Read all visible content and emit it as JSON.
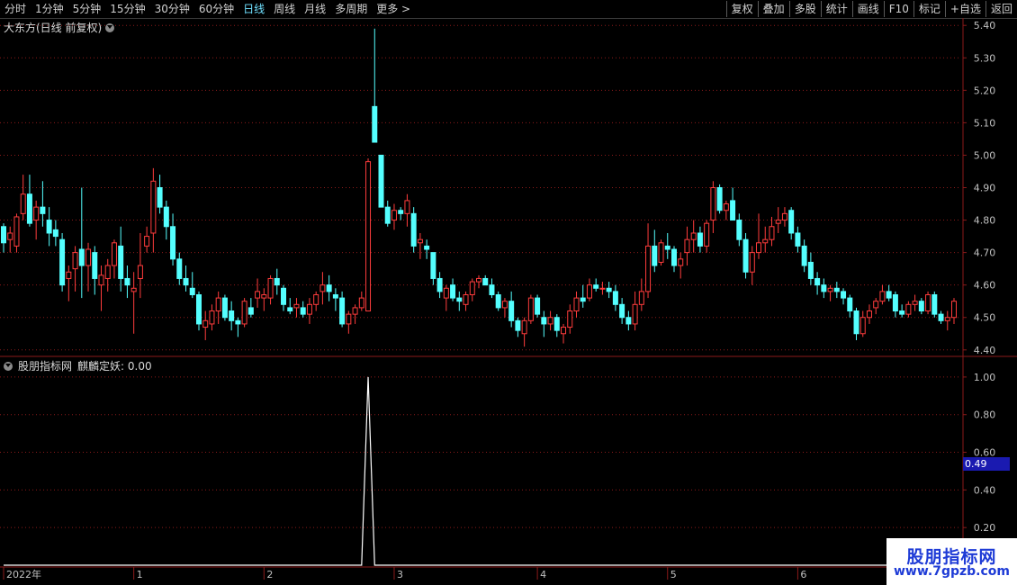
{
  "toolbar": {
    "left_tabs": [
      "分时",
      "1分钟",
      "5分钟",
      "15分钟",
      "30分钟",
      "60分钟",
      "日线",
      "周线",
      "月线",
      "多周期",
      "更多 >"
    ],
    "active_tab": "日线",
    "right_buttons": [
      "复权",
      "叠加",
      "多股",
      "统计",
      "画线",
      "F10",
      "标记",
      "+自选",
      "返回"
    ]
  },
  "main_chart": {
    "title": "大东方(日线 前复权)",
    "y_ticks": [
      "5.40",
      "5.30",
      "5.20",
      "5.10",
      "5.00",
      "4.90",
      "4.80",
      "4.70",
      "4.60",
      "4.50",
      "4.40"
    ]
  },
  "indicator": {
    "source": "股朋指标网",
    "name": "麒麟定妖",
    "value_label": "0.00",
    "y_ticks": [
      "1.00",
      "0.80",
      "0.60",
      "0.40",
      "0.20"
    ],
    "current_value": "0.49"
  },
  "x_axis": {
    "labels": [
      "2022年",
      "1",
      "2",
      "3",
      "4",
      "5",
      "6"
    ]
  },
  "watermark": {
    "line1": "股朋指标网",
    "line2": "www.7gpzb.com"
  },
  "colors": {
    "up": "#ff3c3c",
    "down": "#54ffff",
    "grid": "#8b1a1a",
    "active_tab": "#6fe0ff"
  },
  "chart_data": {
    "type": "candlestick",
    "note_series": "daily OHLC, 2022",
    "candles": [
      [
        4.78,
        4.79,
        4.7,
        4.73
      ],
      [
        4.74,
        4.78,
        4.7,
        4.76
      ],
      [
        4.72,
        4.82,
        4.7,
        4.81
      ],
      [
        4.82,
        4.94,
        4.8,
        4.88
      ],
      [
        4.88,
        4.94,
        4.78,
        4.79
      ],
      [
        4.8,
        4.86,
        4.74,
        4.84
      ],
      [
        4.84,
        4.92,
        4.78,
        4.82
      ],
      [
        4.8,
        4.84,
        4.72,
        4.76
      ],
      [
        4.77,
        4.8,
        4.72,
        4.75
      ],
      [
        4.74,
        4.76,
        4.58,
        4.6
      ],
      [
        4.62,
        4.66,
        4.55,
        4.64
      ],
      [
        4.65,
        4.72,
        4.58,
        4.7
      ],
      [
        4.71,
        4.9,
        4.56,
        4.66
      ],
      [
        4.66,
        4.73,
        4.58,
        4.71
      ],
      [
        4.7,
        4.72,
        4.57,
        4.62
      ],
      [
        4.6,
        4.66,
        4.52,
        4.63
      ],
      [
        4.62,
        4.68,
        4.58,
        4.66
      ],
      [
        4.66,
        4.74,
        4.62,
        4.73
      ],
      [
        4.72,
        4.78,
        4.58,
        4.62
      ],
      [
        4.62,
        4.66,
        4.56,
        4.6
      ],
      [
        4.58,
        4.64,
        4.45,
        4.59
      ],
      [
        4.62,
        4.76,
        4.56,
        4.66
      ],
      [
        4.72,
        4.78,
        4.7,
        4.75
      ],
      [
        4.76,
        4.96,
        4.7,
        4.92
      ],
      [
        4.9,
        4.94,
        4.82,
        4.84
      ],
      [
        4.84,
        4.86,
        4.74,
        4.78
      ],
      [
        4.78,
        4.82,
        4.66,
        4.68
      ],
      [
        4.68,
        4.7,
        4.6,
        4.62
      ],
      [
        4.62,
        4.66,
        4.58,
        4.6
      ],
      [
        4.59,
        4.64,
        4.56,
        4.57
      ],
      [
        4.57,
        4.58,
        4.46,
        4.48
      ],
      [
        4.47,
        4.52,
        4.43,
        4.49
      ],
      [
        4.48,
        4.54,
        4.46,
        4.52
      ],
      [
        4.52,
        4.58,
        4.48,
        4.56
      ],
      [
        4.56,
        4.57,
        4.49,
        4.5
      ],
      [
        4.52,
        4.55,
        4.46,
        4.49
      ],
      [
        4.49,
        4.5,
        4.44,
        4.48
      ],
      [
        4.48,
        4.56,
        4.47,
        4.55
      ],
      [
        4.53,
        4.56,
        4.5,
        4.51
      ],
      [
        4.56,
        4.62,
        4.53,
        4.58
      ],
      [
        4.56,
        4.59,
        4.52,
        4.57
      ],
      [
        4.56,
        4.63,
        4.54,
        4.62
      ],
      [
        4.62,
        4.65,
        4.57,
        4.6
      ],
      [
        4.59,
        4.6,
        4.52,
        4.54
      ],
      [
        4.53,
        4.56,
        4.51,
        4.52
      ],
      [
        4.53,
        4.56,
        4.5,
        4.54
      ],
      [
        4.53,
        4.55,
        4.5,
        4.51
      ],
      [
        4.51,
        4.56,
        4.48,
        4.54
      ],
      [
        4.54,
        4.58,
        4.52,
        4.57
      ],
      [
        4.58,
        4.64,
        4.54,
        4.6
      ],
      [
        4.6,
        4.63,
        4.55,
        4.58
      ],
      [
        4.57,
        4.59,
        4.52,
        4.56
      ],
      [
        4.56,
        4.58,
        4.47,
        4.48
      ],
      [
        4.48,
        4.52,
        4.45,
        4.51
      ],
      [
        4.51,
        4.54,
        4.48,
        4.53
      ],
      [
        4.53,
        4.58,
        4.52,
        4.56
      ],
      [
        4.52,
        4.99,
        4.52,
        4.98
      ],
      [
        5.15,
        5.39,
        5.05,
        5.04
      ],
      [
        5.0,
        5.0,
        4.86,
        4.84
      ],
      [
        4.84,
        4.86,
        4.78,
        4.79
      ],
      [
        4.8,
        4.85,
        4.77,
        4.83
      ],
      [
        4.83,
        4.84,
        4.8,
        4.82
      ],
      [
        4.82,
        4.88,
        4.78,
        4.86
      ],
      [
        4.82,
        4.84,
        4.7,
        4.72
      ],
      [
        4.73,
        4.76,
        4.68,
        4.74
      ],
      [
        4.72,
        4.74,
        4.68,
        4.71
      ],
      [
        4.7,
        4.7,
        4.6,
        4.62
      ],
      [
        4.62,
        4.64,
        4.56,
        4.58
      ],
      [
        4.56,
        4.6,
        4.52,
        4.59
      ],
      [
        4.6,
        4.62,
        4.55,
        4.56
      ],
      [
        4.56,
        4.58,
        4.52,
        4.55
      ],
      [
        4.54,
        4.58,
        4.52,
        4.57
      ],
      [
        4.57,
        4.62,
        4.55,
        4.61
      ],
      [
        4.61,
        4.63,
        4.59,
        4.62
      ],
      [
        4.62,
        4.63,
        4.6,
        4.6
      ],
      [
        4.6,
        4.62,
        4.56,
        4.57
      ],
      [
        4.57,
        4.58,
        4.52,
        4.53
      ],
      [
        4.53,
        4.56,
        4.5,
        4.55
      ],
      [
        4.55,
        4.58,
        4.47,
        4.49
      ],
      [
        4.49,
        4.5,
        4.44,
        4.46
      ],
      [
        4.45,
        4.5,
        4.41,
        4.49
      ],
      [
        4.49,
        4.57,
        4.48,
        4.56
      ],
      [
        4.56,
        4.57,
        4.5,
        4.51
      ],
      [
        4.5,
        4.52,
        4.44,
        4.48
      ],
      [
        4.48,
        4.52,
        4.46,
        4.5
      ],
      [
        4.5,
        4.51,
        4.44,
        4.46
      ],
      [
        4.45,
        4.48,
        4.42,
        4.47
      ],
      [
        4.47,
        4.54,
        4.45,
        4.52
      ],
      [
        4.52,
        4.58,
        4.5,
        4.56
      ],
      [
        4.56,
        4.6,
        4.53,
        4.55
      ],
      [
        4.56,
        4.62,
        4.55,
        4.6
      ],
      [
        4.6,
        4.62,
        4.58,
        4.59
      ],
      [
        4.59,
        4.61,
        4.57,
        4.59
      ],
      [
        4.59,
        4.61,
        4.56,
        4.58
      ],
      [
        4.58,
        4.6,
        4.52,
        4.54
      ],
      [
        4.54,
        4.56,
        4.48,
        4.5
      ],
      [
        4.5,
        4.52,
        4.46,
        4.48
      ],
      [
        4.48,
        4.58,
        4.46,
        4.54
      ],
      [
        4.54,
        4.62,
        4.52,
        4.58
      ],
      [
        4.58,
        4.79,
        4.56,
        4.72
      ],
      [
        4.72,
        4.77,
        4.64,
        4.66
      ],
      [
        4.67,
        4.74,
        4.66,
        4.73
      ],
      [
        4.72,
        4.76,
        4.68,
        4.71
      ],
      [
        4.71,
        4.72,
        4.64,
        4.66
      ],
      [
        4.66,
        4.7,
        4.62,
        4.68
      ],
      [
        4.7,
        4.78,
        4.66,
        4.74
      ],
      [
        4.74,
        4.8,
        4.7,
        4.76
      ],
      [
        4.76,
        4.78,
        4.7,
        4.72
      ],
      [
        4.72,
        4.8,
        4.7,
        4.79
      ],
      [
        4.8,
        4.92,
        4.76,
        4.9
      ],
      [
        4.9,
        4.91,
        4.82,
        4.83
      ],
      [
        4.83,
        4.86,
        4.8,
        4.85
      ],
      [
        4.86,
        4.9,
        4.8,
        4.8
      ],
      [
        4.8,
        4.82,
        4.72,
        4.74
      ],
      [
        4.74,
        4.76,
        4.62,
        4.64
      ],
      [
        4.64,
        4.72,
        4.6,
        4.7
      ],
      [
        4.7,
        4.82,
        4.68,
        4.73
      ],
      [
        4.73,
        4.78,
        4.7,
        4.74
      ],
      [
        4.74,
        4.81,
        4.72,
        4.78
      ],
      [
        4.79,
        4.84,
        4.76,
        4.8
      ],
      [
        4.8,
        4.84,
        4.78,
        4.82
      ],
      [
        4.83,
        4.84,
        4.74,
        4.76
      ],
      [
        4.76,
        4.78,
        4.7,
        4.72
      ],
      [
        4.72,
        4.74,
        4.64,
        4.66
      ],
      [
        4.67,
        4.7,
        4.6,
        4.62
      ],
      [
        4.62,
        4.64,
        4.57,
        4.6
      ],
      [
        4.6,
        4.62,
        4.56,
        4.58
      ],
      [
        4.58,
        4.6,
        4.55,
        4.59
      ],
      [
        4.59,
        4.61,
        4.56,
        4.58
      ],
      [
        4.58,
        4.59,
        4.54,
        4.56
      ],
      [
        4.56,
        4.57,
        4.5,
        4.52
      ],
      [
        4.52,
        4.53,
        4.43,
        4.45
      ],
      [
        4.45,
        4.52,
        4.44,
        4.5
      ],
      [
        4.5,
        4.54,
        4.48,
        4.52
      ],
      [
        4.53,
        4.56,
        4.51,
        4.55
      ],
      [
        4.55,
        4.6,
        4.54,
        4.58
      ],
      [
        4.58,
        4.6,
        4.55,
        4.56
      ],
      [
        4.57,
        4.58,
        4.5,
        4.52
      ],
      [
        4.52,
        4.54,
        4.5,
        4.51
      ],
      [
        4.51,
        4.55,
        4.5,
        4.54
      ],
      [
        4.54,
        4.57,
        4.52,
        4.55
      ],
      [
        4.55,
        4.56,
        4.51,
        4.52
      ],
      [
        4.52,
        4.58,
        4.51,
        4.57
      ],
      [
        4.57,
        4.58,
        4.5,
        4.51
      ],
      [
        4.51,
        4.52,
        4.48,
        4.49
      ],
      [
        4.49,
        4.52,
        4.46,
        4.5
      ],
      [
        4.5,
        4.56,
        4.48,
        4.55
      ]
    ],
    "indicator_values": [
      0,
      0,
      0,
      0,
      0,
      0,
      0,
      0,
      0,
      0,
      0,
      0,
      0,
      0,
      0,
      0,
      0,
      0,
      0,
      0,
      0,
      0,
      0,
      0,
      0,
      0,
      0,
      0,
      0,
      0,
      0,
      0,
      0,
      0,
      0,
      0,
      0,
      0,
      0,
      0,
      0,
      0,
      0,
      0,
      0,
      0,
      0,
      0,
      0,
      0,
      0,
      0,
      0,
      0,
      0,
      0,
      1,
      0,
      0,
      0,
      0,
      0,
      0,
      0,
      0,
      0,
      0,
      0,
      0,
      0,
      0,
      0,
      0,
      0,
      0,
      0,
      0,
      0,
      0,
      0,
      0,
      0,
      0,
      0,
      0,
      0,
      0,
      0,
      0,
      0,
      0,
      0,
      0,
      0,
      0,
      0,
      0,
      0,
      0,
      0,
      0,
      0,
      0,
      0,
      0,
      0,
      0,
      0,
      0,
      0,
      0,
      0,
      0,
      0,
      0,
      0,
      0,
      0,
      0,
      0,
      0,
      0,
      0,
      0,
      0,
      0,
      0,
      0,
      0,
      0,
      0,
      0,
      0,
      0,
      0,
      0,
      0,
      0,
      0,
      0,
      0,
      0,
      0,
      0,
      0,
      0,
      0,
      0,
      0
    ],
    "price_range": [
      4.38,
      5.42
    ],
    "indicator_range": [
      0,
      1.1
    ],
    "month_starts": [
      0,
      20,
      40,
      60,
      82,
      102,
      122
    ]
  }
}
